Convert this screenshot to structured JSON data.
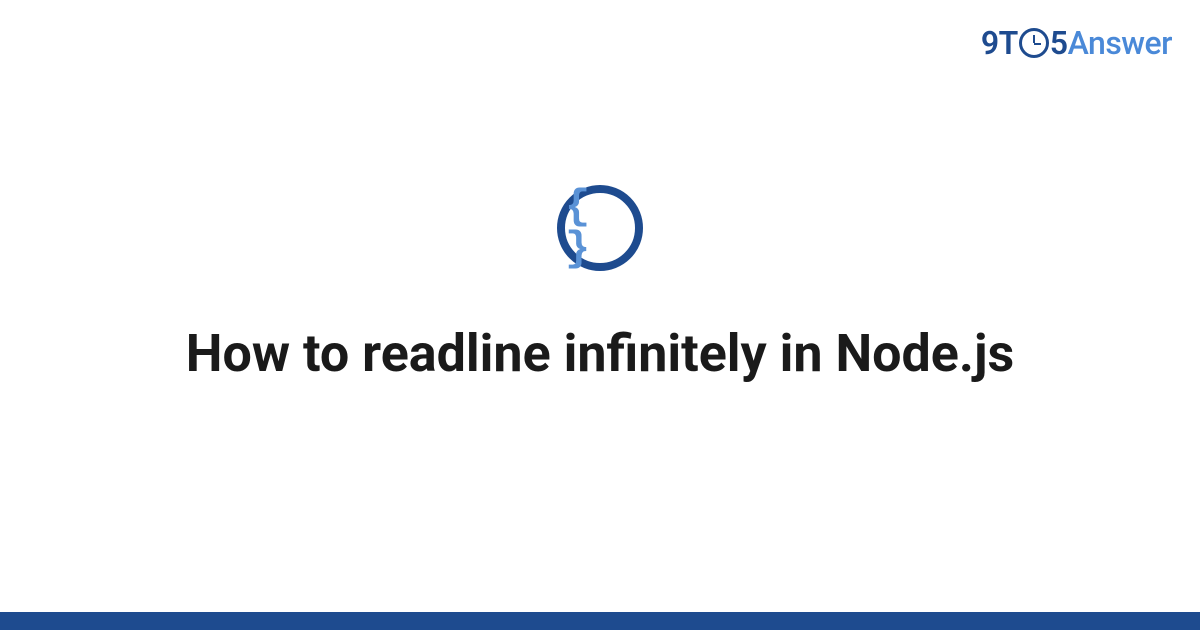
{
  "logo": {
    "nine": "9",
    "t": "T",
    "five": "5",
    "answer": "Answer"
  },
  "icon": {
    "braces": "{ }"
  },
  "title": "How to readline infinitely in Node.js"
}
